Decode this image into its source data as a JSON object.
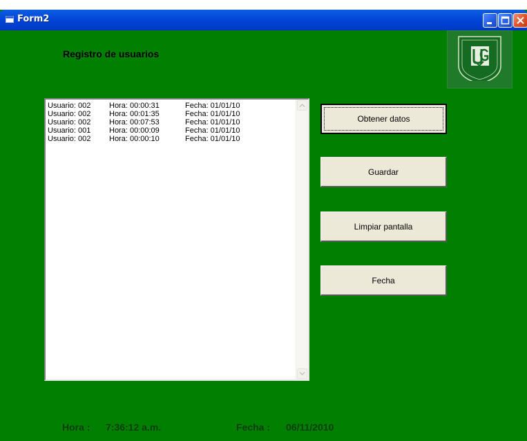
{
  "window": {
    "title": "Form2",
    "controls": {
      "minimize_icon": "minimize-icon",
      "maximize_icon": "maximize-icon",
      "close_icon": "close-icon"
    }
  },
  "heading": "Registro de usuarios",
  "logo": {
    "icon": "university-logo"
  },
  "log_list": {
    "rows": [
      {
        "usuario": "Usuario: 002",
        "hora": "Hora: 00:00:31",
        "fecha": "Fecha: 01/01/10"
      },
      {
        "usuario": "Usuario: 002",
        "hora": "Hora: 00:01:35",
        "fecha": "Fecha: 01/01/10"
      },
      {
        "usuario": "Usuario: 002",
        "hora": "Hora: 00:07:53",
        "fecha": "Fecha: 01/01/10"
      },
      {
        "usuario": "Usuario: 001",
        "hora": "Hora: 00:00:09",
        "fecha": "Fecha: 01/01/10"
      },
      {
        "usuario": "Usuario: 002",
        "hora": "Hora: 00:00:10",
        "fecha": "Fecha: 01/01/10"
      }
    ]
  },
  "buttons": {
    "obtener": "Obtener datos",
    "guardar": "Guardar",
    "limpiar": "Limpiar pantalla",
    "fecha": "Fecha"
  },
  "status": {
    "hora_label": "Hora :",
    "hora_value": "7:36:12 a.m.",
    "fecha_label": "Fecha :",
    "fecha_value": "06/11/2010"
  },
  "colors": {
    "form_background": "#007f00",
    "titlebar": "#0145d8",
    "button_face": "#ece9d8"
  }
}
